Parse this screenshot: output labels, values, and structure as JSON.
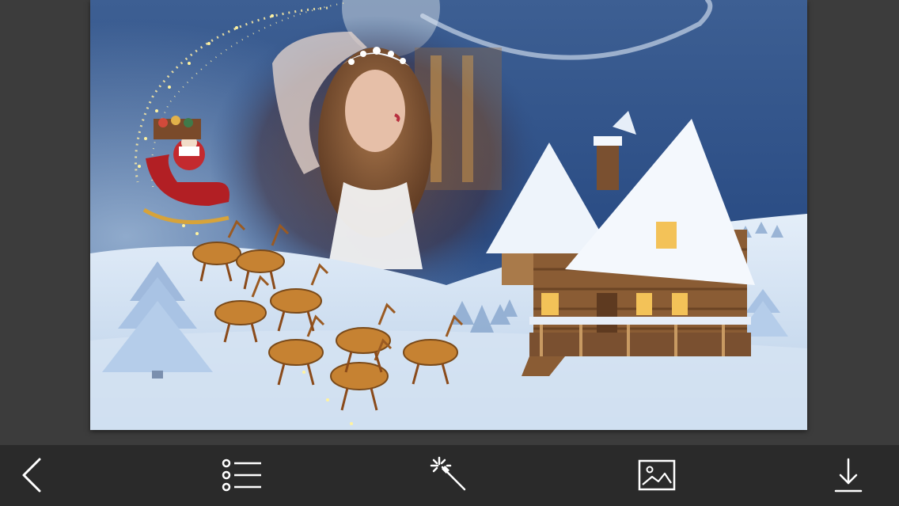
{
  "app": {
    "background": "#3b3b3b",
    "toolbar_background": "#2a2a2a",
    "icon_color": "#ffffff"
  },
  "photo": {
    "scene": "christmas-photo-frame",
    "sky_colors": [
      "#6d8fba",
      "#1f3f76"
    ]
  },
  "toolbar": {
    "buttons": [
      {
        "id": "back",
        "icon": "chevron-left-icon"
      },
      {
        "id": "menu",
        "icon": "list-icon"
      },
      {
        "id": "effects",
        "icon": "magic-wand-icon"
      },
      {
        "id": "gallery",
        "icon": "image-icon"
      },
      {
        "id": "download",
        "icon": "download-icon"
      }
    ]
  }
}
